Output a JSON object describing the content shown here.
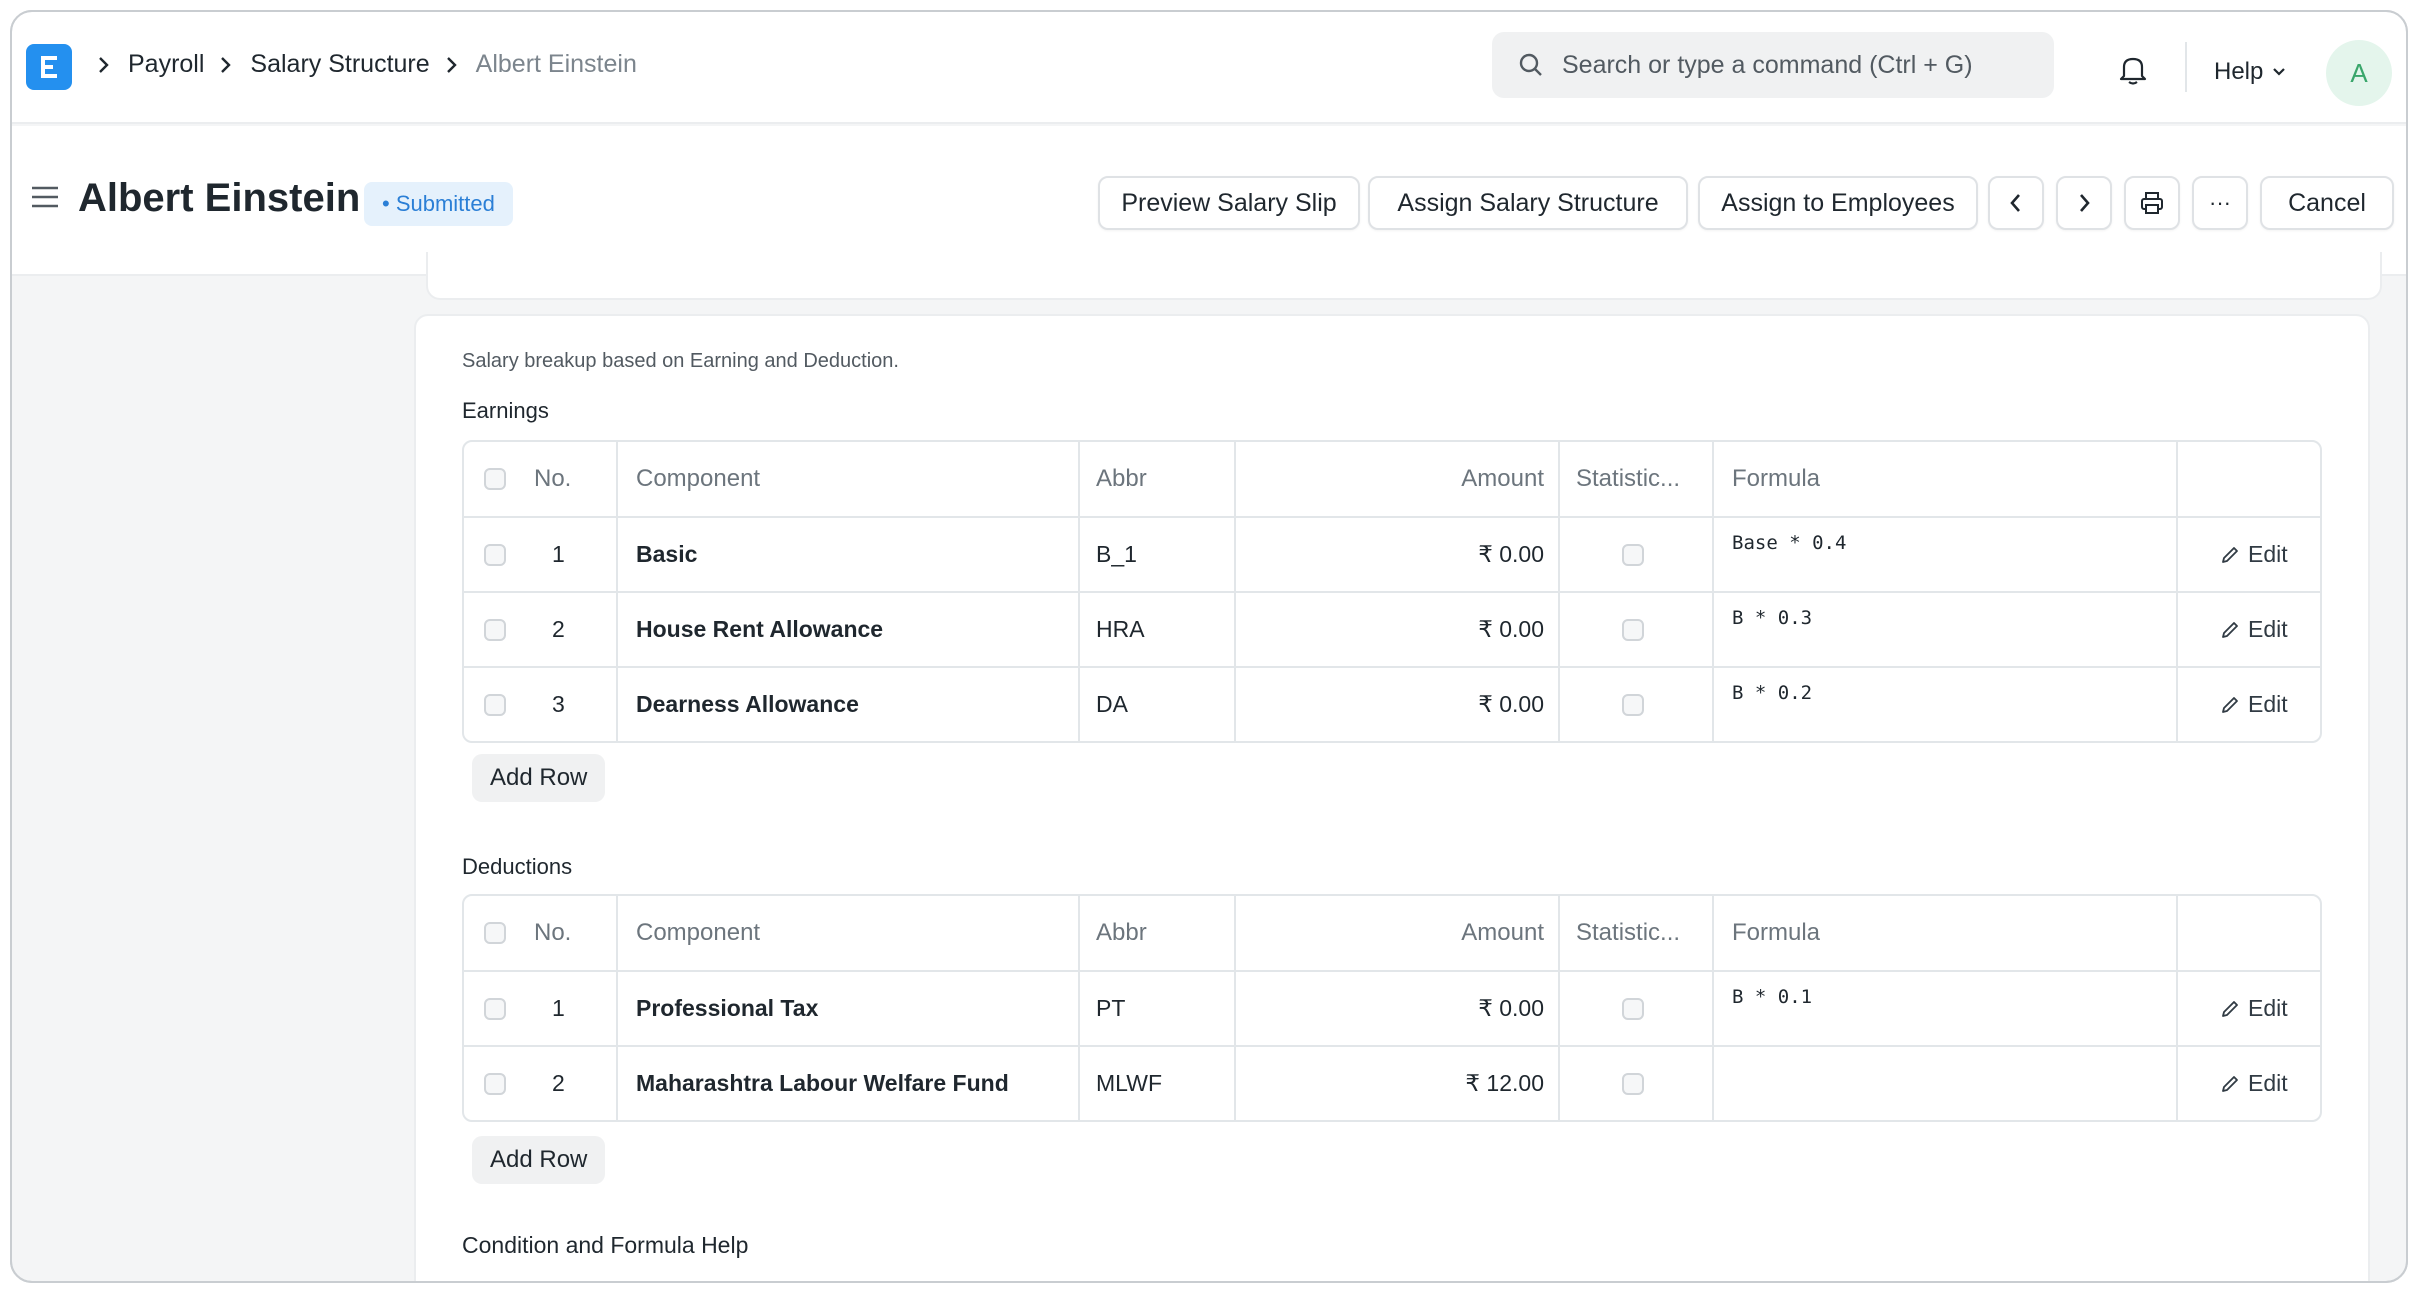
{
  "navbar": {
    "breadcrumbs": [
      "Payroll",
      "Salary Structure",
      "Albert Einstein"
    ],
    "search_placeholder": "Search or type a command (Ctrl + G)",
    "help_label": "Help",
    "avatar_initial": "A"
  },
  "page": {
    "title": "Albert Einstein",
    "status": "• Submitted",
    "actions": {
      "preview": "Preview Salary Slip",
      "assign": "Assign Salary Structure",
      "assign_employees": "Assign to Employees",
      "more": "···",
      "cancel": "Cancel"
    }
  },
  "breakup": {
    "description": "Salary breakup based on Earning and Deduction.",
    "columns": {
      "no": "No.",
      "component": "Component",
      "abbr": "Abbr",
      "amount": "Amount",
      "statistic": "Statistic...",
      "formula": "Formula"
    },
    "edit_label": "Edit",
    "add_row_label": "Add Row",
    "earnings": {
      "label": "Earnings",
      "rows": [
        {
          "no": "1",
          "component": "Basic",
          "abbr": "B_1",
          "amount": "₹ 0.00",
          "formula": "Base * 0.4"
        },
        {
          "no": "2",
          "component": "House Rent Allowance",
          "abbr": "HRA",
          "amount": "₹ 0.00",
          "formula": "B * 0.3"
        },
        {
          "no": "3",
          "component": "Dearness Allowance",
          "abbr": "DA",
          "amount": "₹ 0.00",
          "formula": "B * 0.2"
        }
      ]
    },
    "deductions": {
      "label": "Deductions",
      "rows": [
        {
          "no": "1",
          "component": "Professional Tax",
          "abbr": "PT",
          "amount": "₹ 0.00",
          "formula": "B * 0.1"
        },
        {
          "no": "2",
          "component": "Maharashtra Labour Welfare Fund",
          "abbr": "MLWF",
          "amount": "₹ 12.00",
          "formula": ""
        }
      ]
    },
    "help_label": "Condition and Formula Help"
  }
}
